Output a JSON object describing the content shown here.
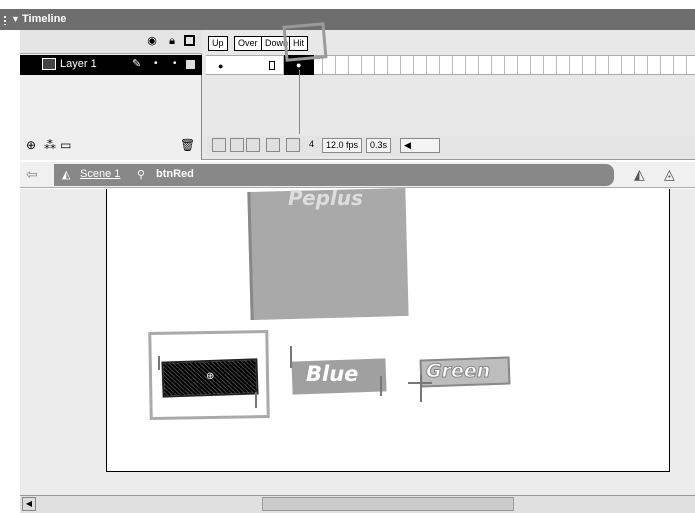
{
  "timeline": {
    "title": "Timeline",
    "layer_name": "Layer 1",
    "frame_labels": [
      "Up",
      "Over",
      "Down",
      "Hit"
    ],
    "current_frame": "4",
    "frame_rate": "12.0 fps",
    "elapsed": "0.3s"
  },
  "editbar": {
    "scene": "Scene 1",
    "symbol": "btnRed"
  },
  "stage": {
    "top_text": "Peplus",
    "blue_label": "Blue",
    "green_label": "Green"
  },
  "icons": [
    "eye-icon",
    "lock-icon",
    "outline-icon",
    "layer-icon",
    "pencil-icon",
    "trash-icon",
    "add-layer-icon",
    "add-guide-icon",
    "add-folder-icon",
    "onion-skin-icon",
    "back-arrow-icon",
    "scene-icon",
    "button-symbol-icon",
    "edit-symbols-icon",
    "edit-scene-icon"
  ],
  "colors": {
    "panel_title_bg": "#6e6e6e",
    "selected_layer_bg": "#000000",
    "scene_strip": "#888888"
  }
}
